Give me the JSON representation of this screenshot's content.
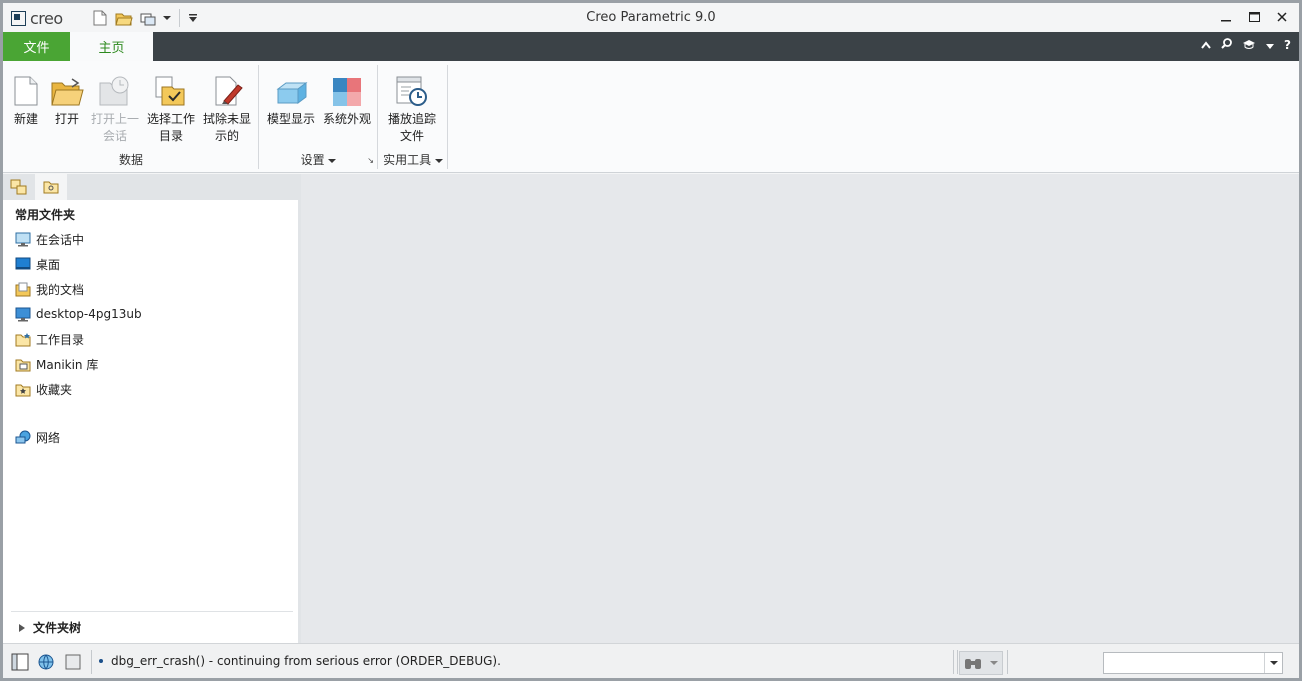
{
  "window": {
    "title": "Creo Parametric 9.0",
    "logo_text": "creo"
  },
  "quick_access": {
    "icons": [
      "new-file-icon",
      "open-folder-icon",
      "window-switch-icon",
      "chevron-down-icon",
      "customize-qat-icon"
    ]
  },
  "ribbon_tabs": {
    "file": "文件",
    "home": "主页"
  },
  "ribbon": {
    "groups": {
      "data": {
        "label": "数据"
      },
      "settings": {
        "label": "设置"
      },
      "utilities": {
        "label": "实用工具"
      }
    },
    "buttons": {
      "new": "新建",
      "open": "打开",
      "open_last_session": "打开上一会话",
      "select_working_dir": "选择工作目录",
      "erase_not_displayed": "拭除未显示的",
      "model_display": "模型显示",
      "system_appearance": "系统外观",
      "play_trail_file": "播放追踪文件"
    },
    "button_lines": {
      "open_last_session": [
        "打开上一",
        "会话"
      ],
      "select_working_dir": [
        "选择工作",
        "目录"
      ],
      "erase_not_displayed": [
        "拭除未显",
        "示的"
      ],
      "play_trail_file": [
        "播放追踪",
        "文件"
      ]
    }
  },
  "navigator": {
    "heading": "常用文件夹",
    "items": [
      {
        "label": "在会话中",
        "icon": "monitor-session-icon"
      },
      {
        "label": "桌面",
        "icon": "desktop-icon"
      },
      {
        "label": "我的文档",
        "icon": "documents-icon"
      },
      {
        "label": "desktop-4pg13ub",
        "icon": "computer-icon"
      },
      {
        "label": "工作目录",
        "icon": "working-dir-folder-icon"
      },
      {
        "label": "Manikin 库",
        "icon": "manikin-library-icon"
      },
      {
        "label": "收藏夹",
        "icon": "favorites-folder-icon"
      },
      {
        "label": "网络",
        "icon": "network-icon"
      }
    ],
    "folder_tree": "文件夹树"
  },
  "status_bar": {
    "message": "dbg_err_crash() - continuing from serious error (ORDER_DEBUG).",
    "filter_value": ""
  },
  "colors": {
    "file_tab": "#4aa534",
    "tab_bar": "#3b4247",
    "home_tab_text": "#2d8a1e",
    "graphics_bg": "#e6e8eb"
  }
}
